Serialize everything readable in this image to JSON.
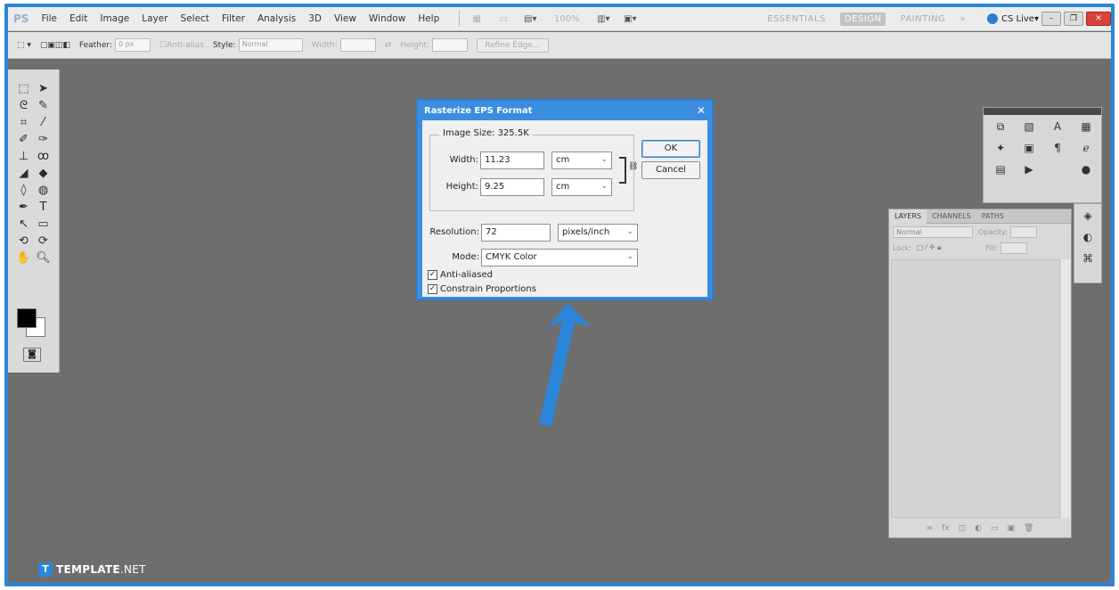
{
  "app": {
    "logo": "PS",
    "colors": {
      "accent": "#2a86d8",
      "canvas": "#6e6e6e"
    }
  },
  "menubar": {
    "items": [
      "File",
      "Edit",
      "Image",
      "Layer",
      "Select",
      "Filter",
      "Analysis",
      "3D",
      "View",
      "Window",
      "Help"
    ],
    "zoom": "100%",
    "workspaces": [
      "ESSENTIALS",
      "DESIGN",
      "PAINTING",
      "»"
    ],
    "cslive": "CS Live"
  },
  "optionsbar": {
    "feather_label": "Feather:",
    "feather_value": "0 px",
    "antialias_label": "Anti-alias",
    "style_label": "Style:",
    "style_value": "Normal",
    "width_label": "Width:",
    "height_label": "Height:",
    "refine_button": "Refine Edge..."
  },
  "dialog": {
    "title": "Rasterize EPS Format",
    "image_size": "Image Size: 325.5K",
    "width_label": "Width:",
    "width_value": "11.23",
    "width_unit": "cm",
    "height_label": "Height:",
    "height_value": "9.25",
    "height_unit": "cm",
    "resolution_label": "Resolution:",
    "resolution_value": "72",
    "resolution_unit": "pixels/inch",
    "mode_label": "Mode:",
    "mode_value": "CMYK Color",
    "antialiased_label": "Anti-aliased",
    "antialiased_checked": true,
    "constrain_label": "Constrain Proportions",
    "constrain_checked": true,
    "ok_label": "OK",
    "cancel_label": "Cancel"
  },
  "layers_panel": {
    "tabs": [
      "LAYERS",
      "CHANNELS",
      "PATHS"
    ],
    "blend_mode": "Normal",
    "opacity_label": "Opacity:",
    "lock_label": "Lock:",
    "fill_label": "Fill:"
  },
  "watermark": {
    "brand": "TEMPLATE",
    "suffix": ".NET"
  }
}
